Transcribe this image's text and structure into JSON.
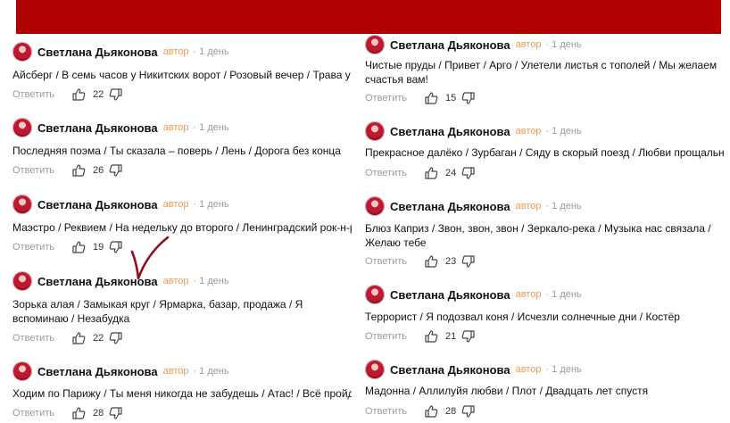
{
  "colors": {
    "banner": "#b10000",
    "author_role": "#f29a54",
    "muted": "#9a9a9a"
  },
  "icons": {
    "avatar": "user-avatar",
    "like": "thumb-up-icon",
    "dislike": "thumb-down-icon",
    "check": "handwritten-checkmark"
  },
  "left_column": [
    {
      "author": "Светлана Дьяконова",
      "role": "автор",
      "sep": "·",
      "age": "1 день",
      "text": "Айсберг / В семь часов у Никитских ворот / Розовый вечер / Трава у дом",
      "reply": "Ответить",
      "likes": "22"
    },
    {
      "author": "Светлана Дьяконова",
      "role": "автор",
      "sep": "·",
      "age": "1 день",
      "text": "Последняя поэма / Ты сказала – поверь / Лень / Дорога без конца",
      "reply": "Ответить",
      "likes": "26"
    },
    {
      "author": "Светлана Дьяконова",
      "role": "автор",
      "sep": "·",
      "age": "1 день",
      "text": "Маэстро / Реквием / На недельку до второго / Ленинградский рок-н-рол",
      "reply": "Ответить",
      "likes": "19"
    },
    {
      "author": "Светлана Дьяконова",
      "role": "автор",
      "sep": "·",
      "age": "1 день",
      "text": "Зорька алая / Замыкая круг / Ярмарка, базар, продажа / Я вспоминаю / Незабудка",
      "reply": "Ответить",
      "likes": "22"
    },
    {
      "author": "Светлана Дьяконова",
      "role": "автор",
      "sep": "·",
      "age": "1 день",
      "text": "Ходим по Парижу / Ты меня никогда не забудешь / Атас! / Всё пройдёт",
      "reply": "Ответить",
      "likes": "28"
    }
  ],
  "right_column": [
    {
      "author": "Светлана Дьяконова",
      "role": "автор",
      "sep": "·",
      "age": "1 день",
      "text": "Чистые пруды / Привет / Арго / Улетели листья с тополей / Мы желаем счастья вам!",
      "reply": "Ответить",
      "likes": "15"
    },
    {
      "author": "Светлана Дьяконова",
      "role": "автор",
      "sep": "·",
      "age": "1 день",
      "text": "Прекрасное далёко / Зурбаган / Сяду в скорый поезд / Любви прощальный бал",
      "reply": "Ответить",
      "likes": "24"
    },
    {
      "author": "Светлана Дьяконова",
      "role": "автор",
      "sep": "·",
      "age": "1 день",
      "text": "Блюз Каприз / Звон, звон, звон / Зеркало-река / Музыка нас связала / Желаю тебе",
      "reply": "Ответить",
      "likes": "23"
    },
    {
      "author": "Светлана Дьяконова",
      "role": "автор",
      "sep": "·",
      "age": "1 день",
      "text": "Террорист / Я подозвал коня / Исчезли солнечные дни / Костёр",
      "reply": "Ответить",
      "likes": "21"
    },
    {
      "author": "Светлана Дьяконова",
      "role": "автор",
      "sep": "·",
      "age": "1 день",
      "text": "Мадонна / Аллилуйя любви / Плот / Двадцать лет спустя",
      "reply": "Ответить",
      "likes": "28"
    }
  ]
}
